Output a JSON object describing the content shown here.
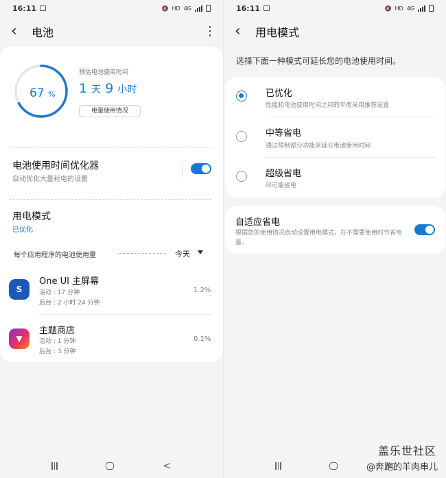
{
  "left": {
    "status": {
      "time": "16:11",
      "hd": "HD",
      "net": "4G"
    },
    "appbar": {
      "back": "‹",
      "title": "电池",
      "more": "⋮"
    },
    "battery": {
      "level_percent": 67,
      "percent_num": "67",
      "percent_sign": "%",
      "estimate_label": "预估电池使用时间",
      "estimate_days": "1",
      "estimate_days_unit": "天",
      "estimate_hours": "9",
      "estimate_hours_unit": "小时",
      "usage_button": "电量使用情况"
    },
    "optimizer": {
      "title": "电池使用时间优化器",
      "subtitle": "自动优化大量耗电的设置",
      "enabled": true
    },
    "power_mode": {
      "title": "用电模式",
      "value": "已优化"
    },
    "per_app": {
      "header": "每个应用程序的电池使用量",
      "filter": "今天"
    },
    "apps": [
      {
        "name": "One UI 主屏幕",
        "active": "活动 : 17 分钟",
        "background": "后台 : 2 小时 24 分钟",
        "percent": "1.2%",
        "icon": "home-screen-icon"
      },
      {
        "name": "主题商店",
        "active": "活动 : 1 分钟",
        "background": "后台 : 3 分钟",
        "percent": "0.1%",
        "icon": "theme-store-icon"
      }
    ]
  },
  "right": {
    "status": {
      "time": "16:11",
      "hd": "HD",
      "net": "4G"
    },
    "appbar": {
      "back": "‹",
      "title": "用电模式"
    },
    "prompt": "选择下面一种模式可延长您的电池使用时间。",
    "options": [
      {
        "title": "已优化",
        "desc": "性能和电池使用时间之间的平衡采用推荐设置",
        "selected": true
      },
      {
        "title": "中等省电",
        "desc": "通过限制部分功能来延长电池使用时间",
        "selected": false
      },
      {
        "title": "超级省电",
        "desc": "尽可能省电",
        "selected": false
      }
    ],
    "adaptive": {
      "title": "自适应省电",
      "desc": "根据您的使用情况自动设置用电模式，在不需要使用时节省电量。",
      "enabled": true
    }
  },
  "watermark": {
    "line1": "盖乐世社区",
    "line2": "@奔跑的羊肉串儿"
  },
  "colors": {
    "accent": "#1b79ce",
    "background": "#f4f4f4",
    "card": "#ffffff"
  }
}
